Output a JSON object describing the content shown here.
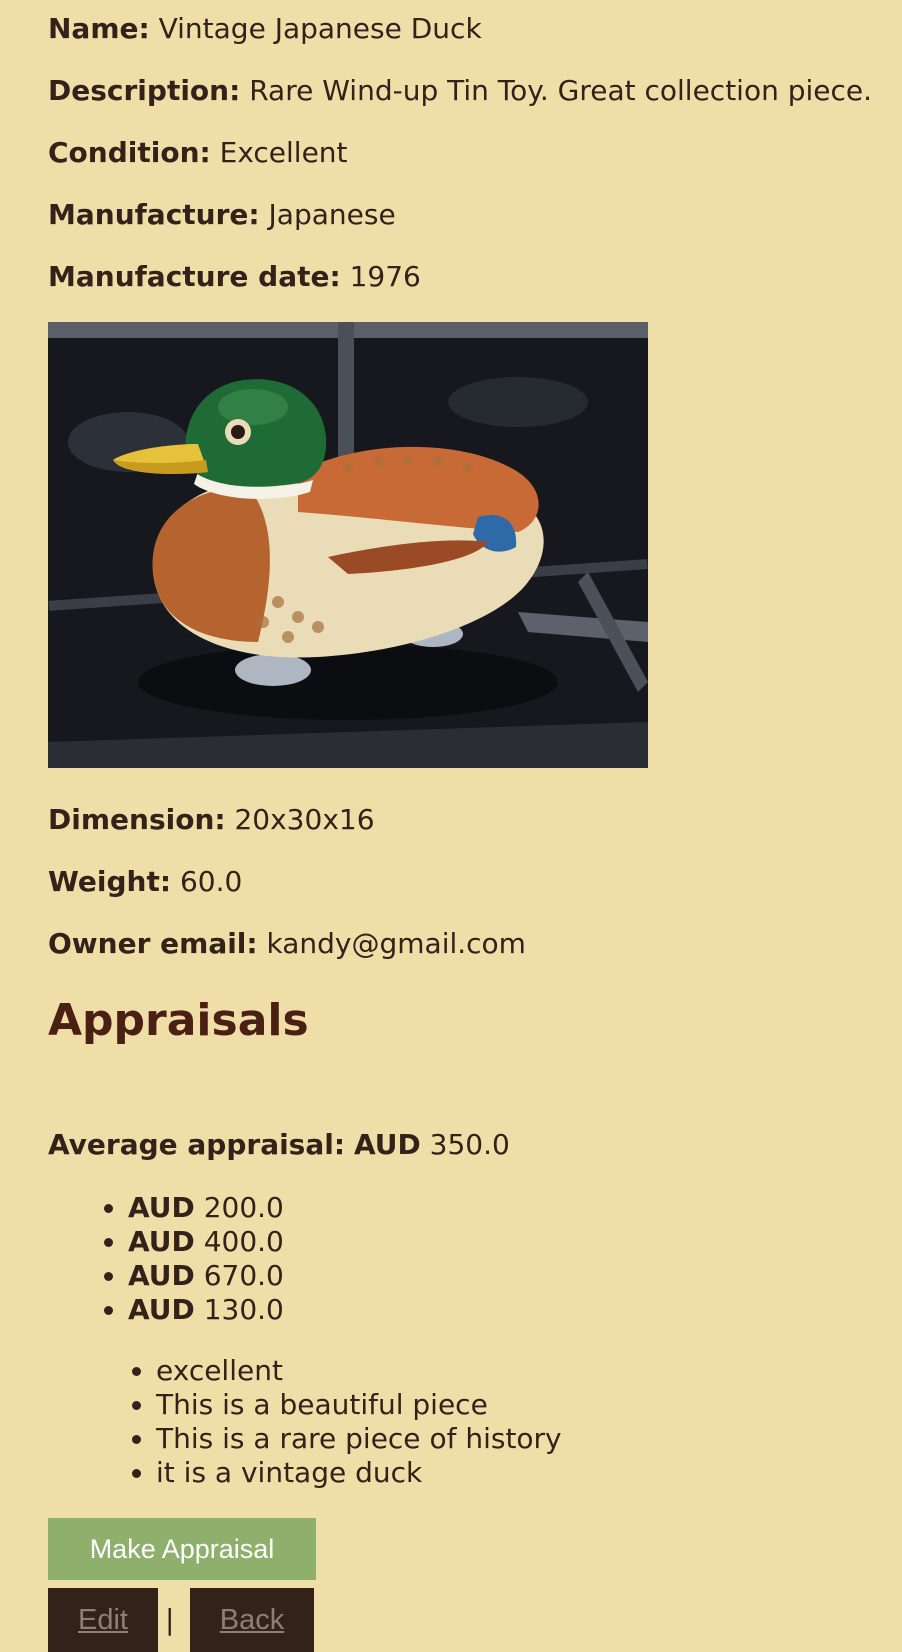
{
  "details": {
    "name_label": "Name:",
    "name_value": "Vintage Japanese Duck",
    "description_label": "Description:",
    "description_value": "Rare Wind-up Tin Toy. Great collection piece.",
    "condition_label": "Condition:",
    "condition_value": "Excellent",
    "manufacture_label": "Manufacture:",
    "manufacture_value": "Japanese",
    "manufacture_date_label": "Manufacture date:",
    "manufacture_date_value": "1976",
    "dimension_label": "Dimension:",
    "dimension_value": "20x30x16",
    "weight_label": "Weight:",
    "weight_value": "60.0",
    "owner_email_label": "Owner email:",
    "owner_email_value": "kandy@gmail.com"
  },
  "photo": {
    "subject": "tin-toy-mallard-duck-photo"
  },
  "appraisals": {
    "heading": "Appraisals",
    "average_label": "Average appraisal:",
    "average_currency": "AUD",
    "average_value": "350.0",
    "values": [
      {
        "currency": "AUD",
        "amount": "200.0"
      },
      {
        "currency": "AUD",
        "amount": "400.0"
      },
      {
        "currency": "AUD",
        "amount": "670.0"
      },
      {
        "currency": "AUD",
        "amount": "130.0"
      }
    ],
    "comments": [
      "excellent",
      "This is a beautiful piece",
      "This is a rare piece of history",
      "it is a vintage duck"
    ]
  },
  "actions": {
    "make_appraisal_label": "Make Appraisal",
    "edit_label": "Edit",
    "separator": "|",
    "back_label": "Back"
  },
  "colors": {
    "page_background": "#f0dea8",
    "text": "#33221a",
    "heading": "#4a2015",
    "make_button": "#8faf6c",
    "nav_button": "#33221a"
  }
}
